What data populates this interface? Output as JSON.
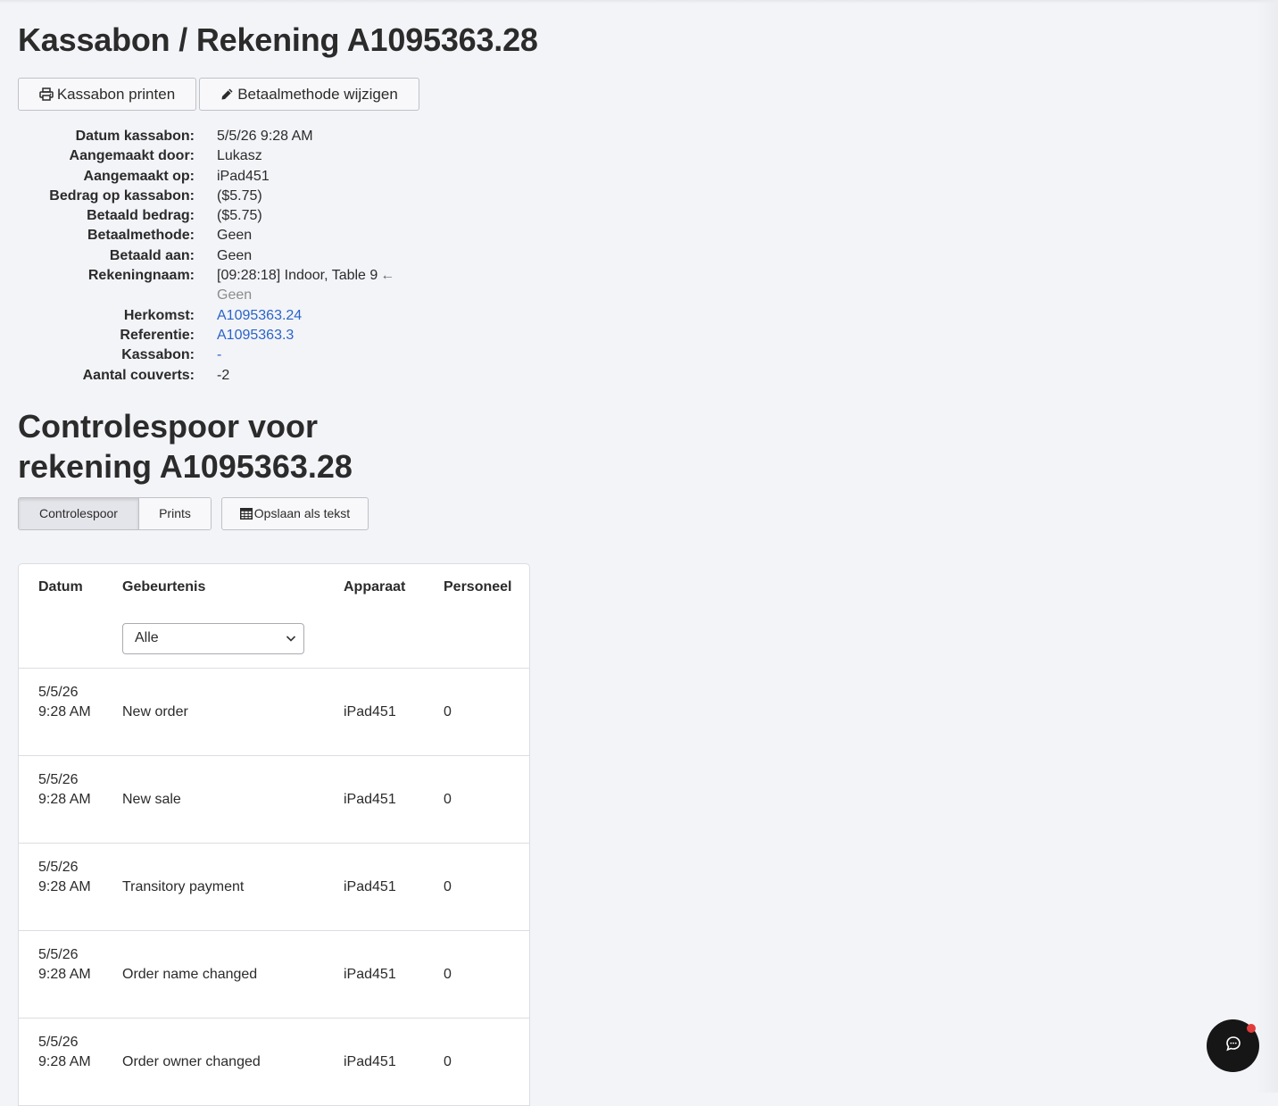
{
  "page": {
    "title": "Kassabon / Rekening A1095363.28"
  },
  "actions": {
    "print_label": "Kassabon printen",
    "change_payment_label": "Betaalmethode wijzigen"
  },
  "info": {
    "receipt_date": {
      "label": "Datum kassabon:",
      "value": "5/5/26 9:28 AM"
    },
    "created_by": {
      "label": "Aangemaakt door:",
      "value": "Lukasz"
    },
    "created_on": {
      "label": "Aangemaakt op:",
      "value": "iPad451"
    },
    "receipt_amount": {
      "label": "Bedrag op kassabon:",
      "value": "($5.75)"
    },
    "paid_amount": {
      "label": "Betaald bedrag:",
      "value": "($5.75)"
    },
    "payment_method": {
      "label": "Betaalmethode:",
      "value": "Geen"
    },
    "paid_to": {
      "label": "Betaald aan:",
      "value": "Geen"
    },
    "account_name": {
      "label": "Rekeningnaam:",
      "value": "[09:28:18] Indoor, Table 9",
      "arrow": "←",
      "previous": "Geen"
    },
    "origin": {
      "label": "Herkomst:",
      "value": "A1095363.24"
    },
    "reference": {
      "label": "Referentie:",
      "value": "A1095363.3"
    },
    "receipt": {
      "label": "Kassabon:",
      "value": "-"
    },
    "covers": {
      "label": "Aantal couverts:",
      "value": "-2"
    }
  },
  "audit": {
    "title": "Controlespoor voor rekening A1095363.28",
    "tabs": [
      "Controlespoor",
      "Prints"
    ],
    "active_tab": "Controlespoor",
    "save_label": "Opslaan als tekst",
    "columns": [
      "Datum",
      "Gebeurtenis",
      "Apparaat",
      "Personeel"
    ],
    "filter_value": "Alle",
    "rows": [
      {
        "date": "5/5/26 9:28 AM",
        "event": "New order",
        "device": "iPad451",
        "staff": "0"
      },
      {
        "date": "5/5/26 9:28 AM",
        "event": "New sale",
        "device": "iPad451",
        "staff": "0"
      },
      {
        "date": "5/5/26 9:28 AM",
        "event": "Transitory payment",
        "device": "iPad451",
        "staff": "0"
      },
      {
        "date": "5/5/26 9:28 AM",
        "event": "Order name changed",
        "device": "iPad451",
        "staff": "0"
      },
      {
        "date": "5/5/26 9:28 AM",
        "event": "Order owner changed",
        "device": "iPad451",
        "staff": "0"
      }
    ]
  },
  "icons": {
    "print": "printer-icon",
    "edit": "pencil-icon",
    "table": "table-icon",
    "chat": "chat-icon"
  },
  "colors": {
    "background": "#f3f4f8",
    "link": "#2a63c9",
    "chat_button": "#161616",
    "notification_dot": "#e23b3b"
  }
}
